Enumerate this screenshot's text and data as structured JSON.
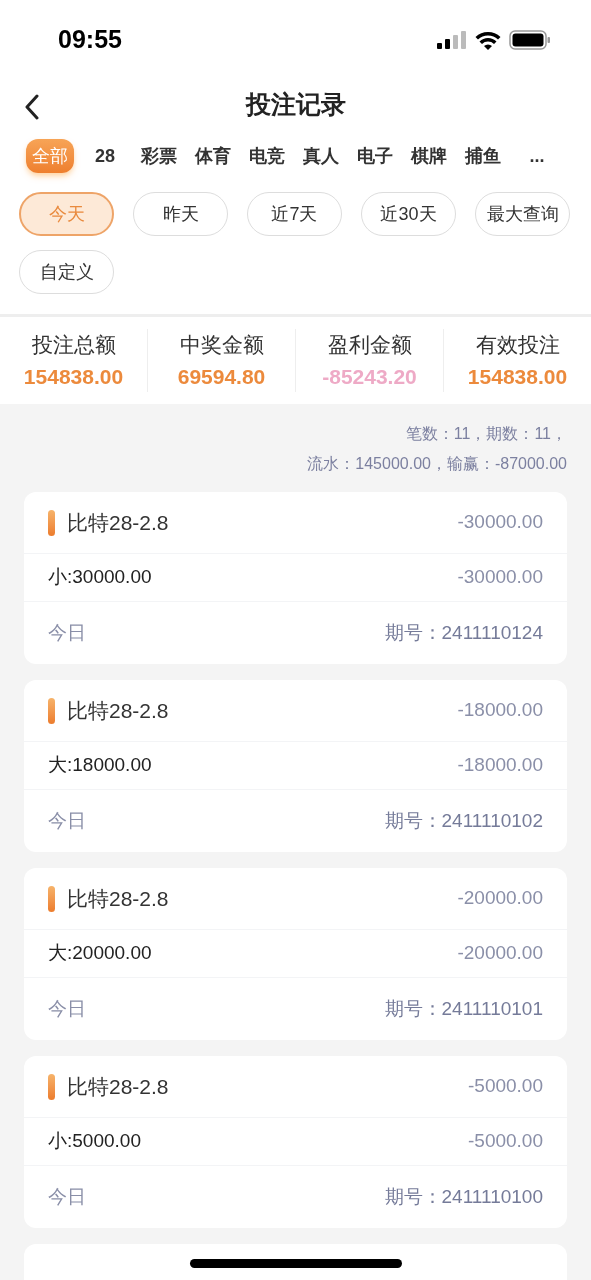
{
  "status_bar": {
    "time": "09:55"
  },
  "header": {
    "title": "投注记录"
  },
  "categories": [
    {
      "label": "全部",
      "selected": true
    },
    {
      "label": "28",
      "selected": false
    },
    {
      "label": "彩票",
      "selected": false
    },
    {
      "label": "体育",
      "selected": false
    },
    {
      "label": "电竞",
      "selected": false
    },
    {
      "label": "真人",
      "selected": false
    },
    {
      "label": "电子",
      "selected": false
    },
    {
      "label": "棋牌",
      "selected": false
    },
    {
      "label": "捕鱼",
      "selected": false
    },
    {
      "label": "...",
      "selected": false
    }
  ],
  "date_filters": [
    {
      "label": "今天",
      "selected": true
    },
    {
      "label": "昨天",
      "selected": false
    },
    {
      "label": "近7天",
      "selected": false
    },
    {
      "label": "近30天",
      "selected": false
    },
    {
      "label": "最大查询",
      "selected": false
    },
    {
      "label": "自定义",
      "selected": false
    }
  ],
  "summary": [
    {
      "label": "投注总额",
      "value": "154838.00",
      "color": "#ec8a3c"
    },
    {
      "label": "中奖金额",
      "value": "69594.80",
      "color": "#ec8a3c"
    },
    {
      "label": "盈利金额",
      "value": "-85243.20",
      "color": "#eeaac6"
    },
    {
      "label": "有效投注",
      "value": "154838.00",
      "color": "#ec8a3c"
    }
  ],
  "stats": [
    "笔数：11，期数：11，",
    "流水：145000.00，输赢：-87000.00"
  ],
  "records": [
    {
      "game": "比特28-2.8",
      "amount": "-30000.00",
      "bet": "小:30000.00",
      "result": "-30000.00",
      "date": "今日",
      "period": "期号：2411110124"
    },
    {
      "game": "比特28-2.8",
      "amount": "-18000.00",
      "bet": "大:18000.00",
      "result": "-18000.00",
      "date": "今日",
      "period": "期号：2411110102"
    },
    {
      "game": "比特28-2.8",
      "amount": "-20000.00",
      "bet": "大:20000.00",
      "result": "-20000.00",
      "date": "今日",
      "period": "期号：2411110101"
    },
    {
      "game": "比特28-2.8",
      "amount": "-5000.00",
      "bet": "小:5000.00",
      "result": "-5000.00",
      "date": "今日",
      "period": "期号：2411110100"
    }
  ]
}
